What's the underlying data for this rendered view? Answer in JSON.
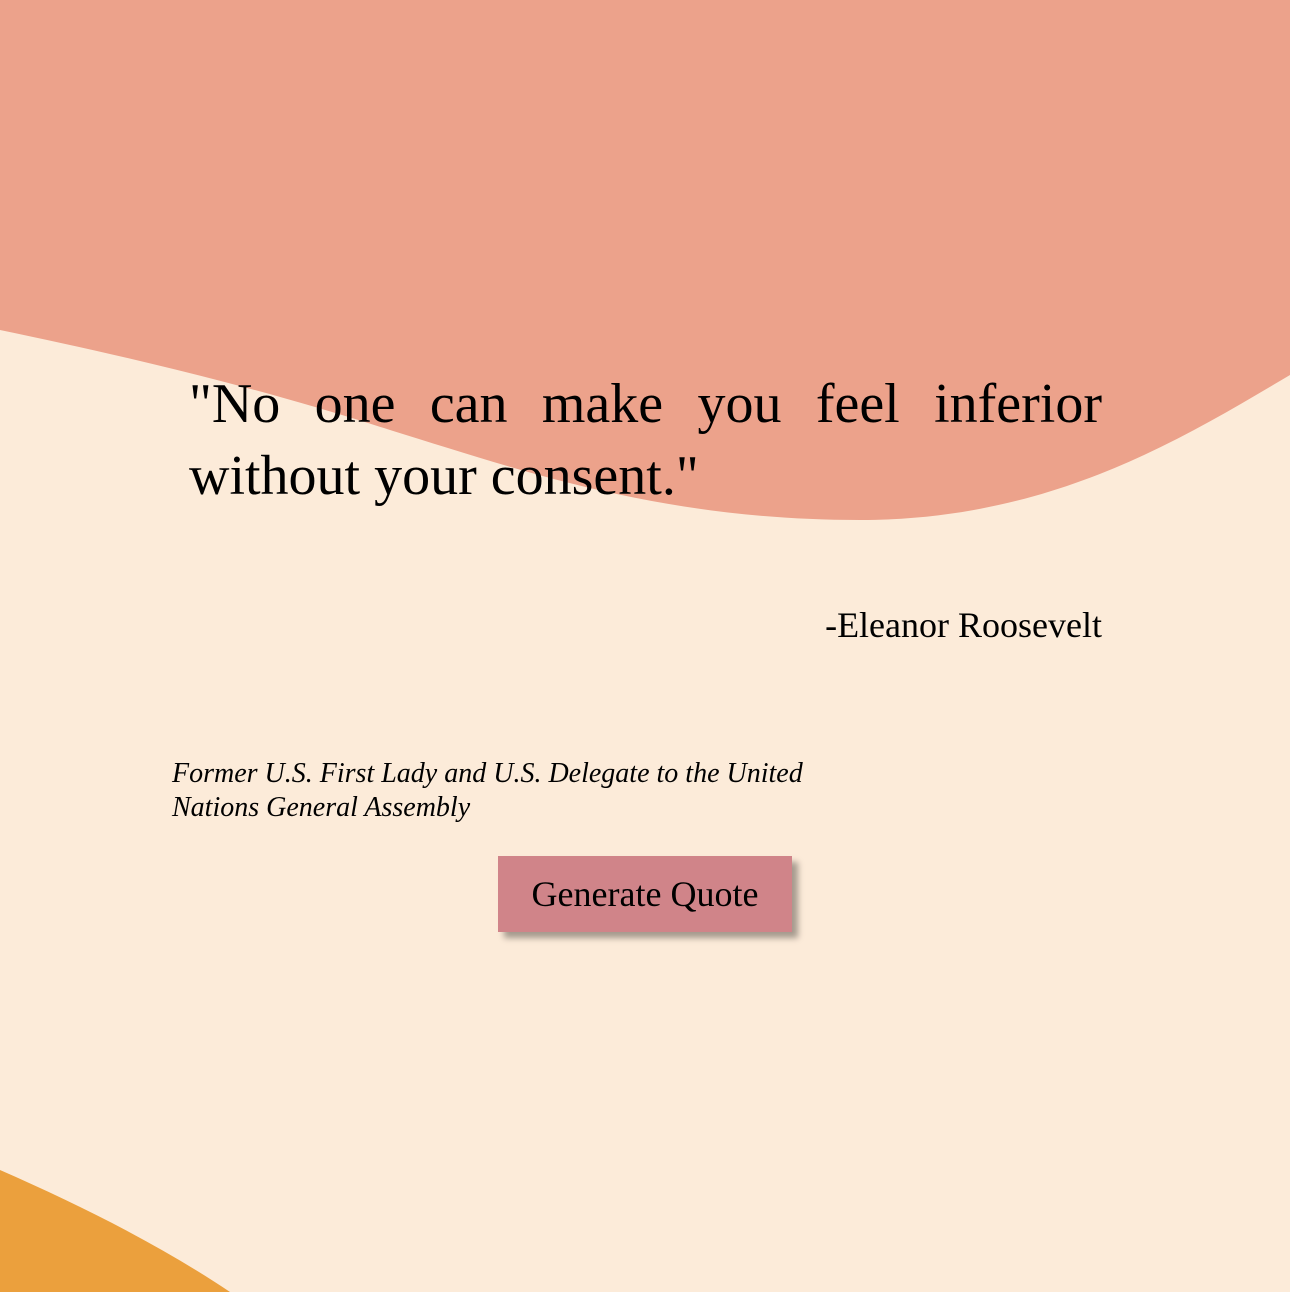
{
  "quote": {
    "text": "\"No one can make you feel inferior without your consent.\"",
    "author": "-Eleanor Roosevelt",
    "description": "Former U.S. First Lady and U.S. Delegate to the United Nations General Assembly"
  },
  "actions": {
    "generate_label": "Generate Quote"
  },
  "colors": {
    "background": "#fcebd9",
    "top_wave": "#eca28b",
    "bottom_wave": "#eba03d",
    "button": "#d08489",
    "topbar": "#333333"
  }
}
